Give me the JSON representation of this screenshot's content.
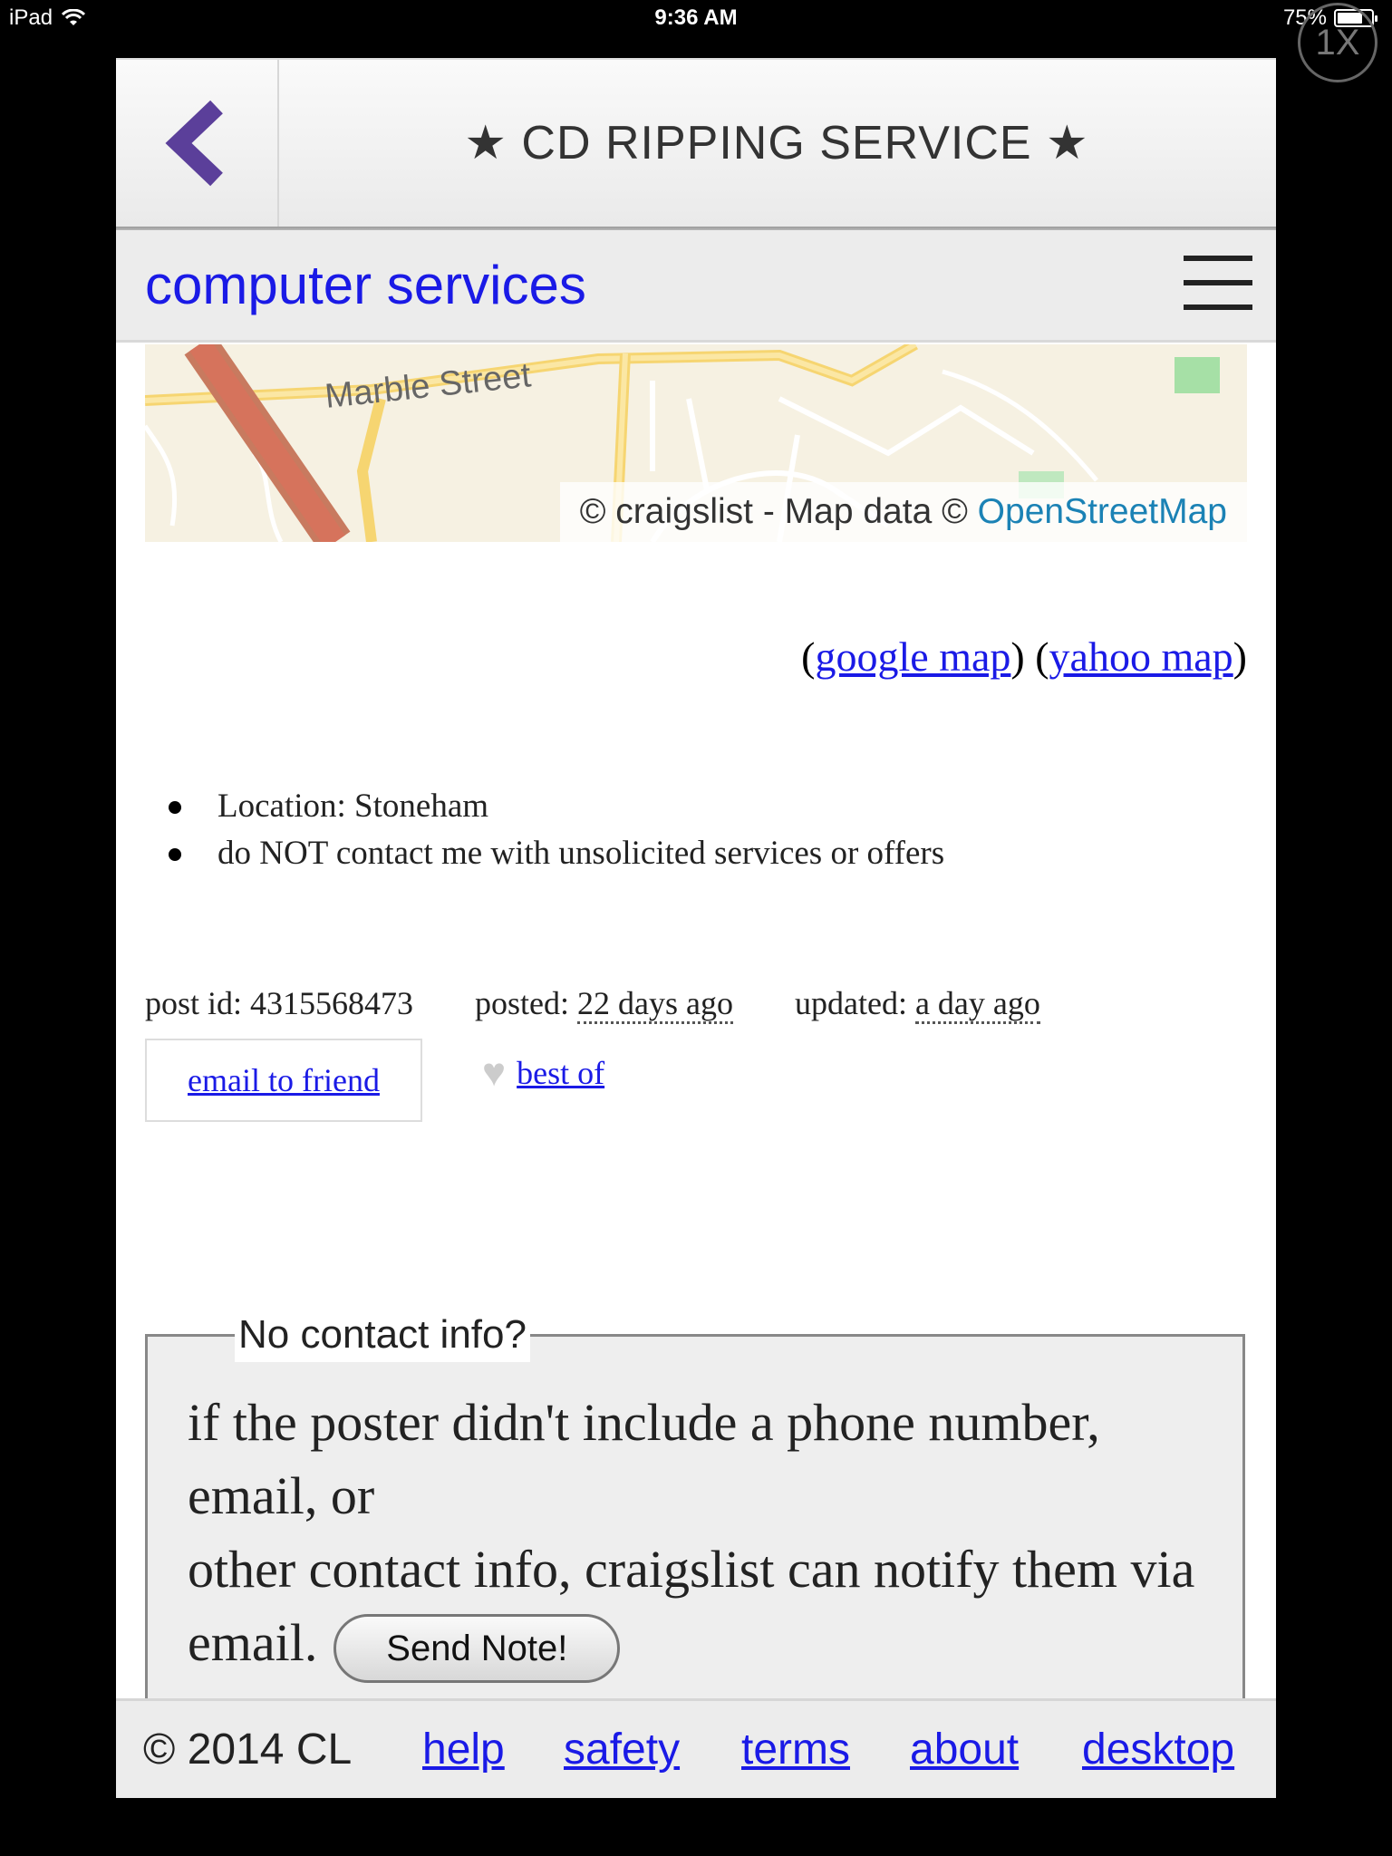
{
  "status_bar": {
    "device": "iPad",
    "time": "9:36 AM",
    "battery": "75%",
    "battery_level": 0.75,
    "zoom_badge": "1X"
  },
  "header": {
    "back_icon": "chevron-left-icon",
    "title": "★ CD RIPPING SERVICE ★",
    "accent_color": "#5b3f9a"
  },
  "category": {
    "label": "computer services",
    "menu_icon": "hamburger-menu-icon"
  },
  "map": {
    "street_label": "Marble Street",
    "attribution_prefix": "© craigslist - Map data © ",
    "attribution_link": "OpenStreetMap"
  },
  "map_links": {
    "google": "google map",
    "yahoo": "yahoo map"
  },
  "attributes": [
    "Location: Stoneham",
    "do NOT contact me with unsolicited services or offers"
  ],
  "post_info": {
    "post_id_label": "post id: 4315568473",
    "posted_label": "posted:",
    "posted_value": "22 days ago",
    "updated_label": "updated:",
    "updated_value": "a day ago"
  },
  "actions": {
    "email_friend": "email to friend",
    "best_of": "best of",
    "heart_icon": "heart-icon"
  },
  "contact_notice": {
    "legend": "No contact info?",
    "line1": "if the poster didn't include a phone number, email, or",
    "line2": "other contact info, craigslist can notify them via email.",
    "button": "Send Note!"
  },
  "footer": {
    "copyright": "© 2014 CL",
    "links": [
      "help",
      "safety",
      "terms",
      "about",
      "desktop"
    ]
  }
}
